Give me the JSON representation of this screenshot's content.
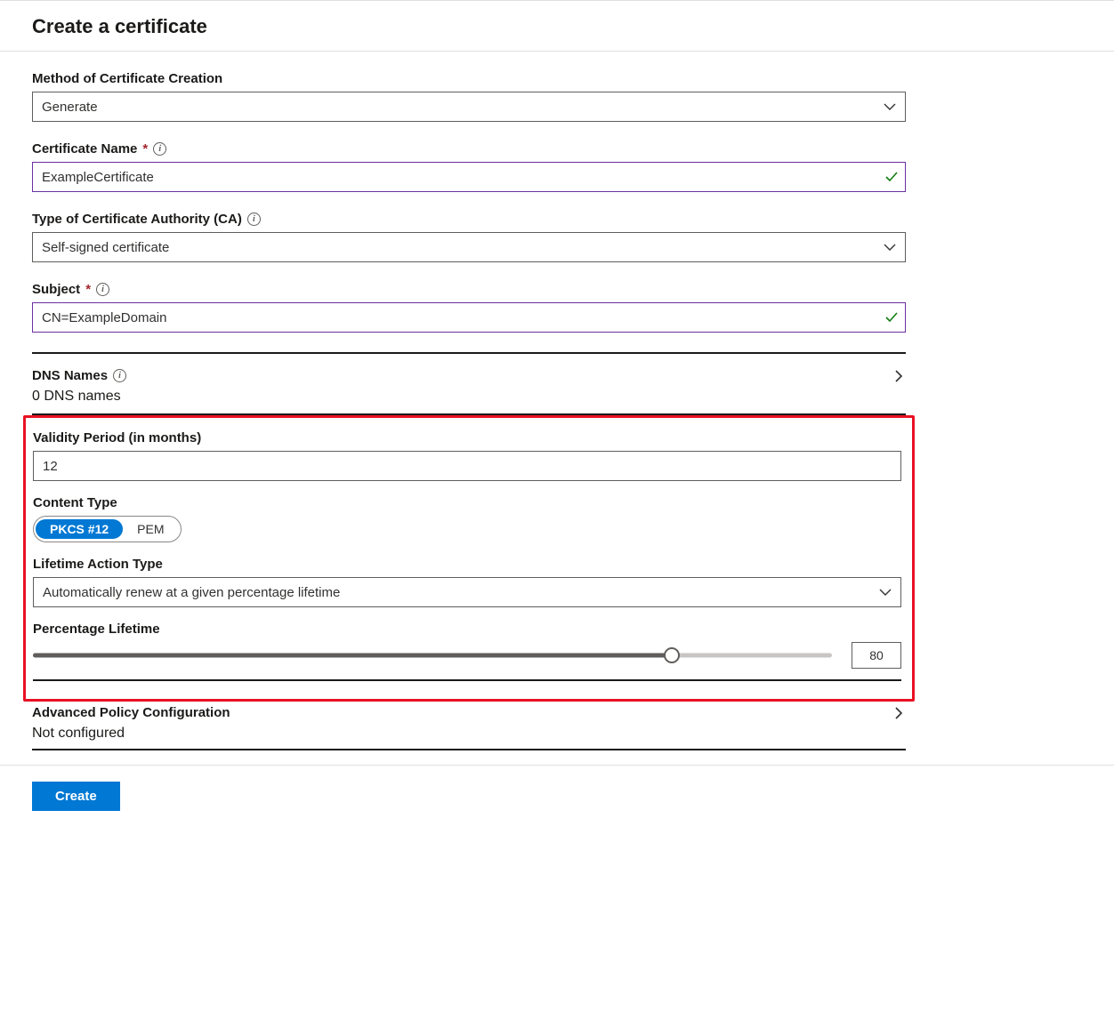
{
  "page": {
    "title": "Create a certificate"
  },
  "fields": {
    "method": {
      "label": "Method of Certificate Creation",
      "value": "Generate"
    },
    "certName": {
      "label": "Certificate Name",
      "value": "ExampleCertificate"
    },
    "caType": {
      "label": "Type of Certificate Authority (CA)",
      "value": "Self-signed certificate"
    },
    "subject": {
      "label": "Subject",
      "value": "CN=ExampleDomain"
    },
    "dnsNames": {
      "label": "DNS Names",
      "value": "0 DNS names"
    },
    "validity": {
      "label": "Validity Period (in months)",
      "value": "12"
    },
    "contentType": {
      "label": "Content Type",
      "options": [
        "PKCS #12",
        "PEM"
      ],
      "selected": "PKCS #12"
    },
    "lifetimeAction": {
      "label": "Lifetime Action Type",
      "value": "Automatically renew at a given percentage lifetime"
    },
    "percentLifetime": {
      "label": "Percentage Lifetime",
      "value": 80
    },
    "advancedPolicy": {
      "label": "Advanced Policy Configuration",
      "value": "Not configured"
    }
  },
  "footer": {
    "create": "Create"
  }
}
